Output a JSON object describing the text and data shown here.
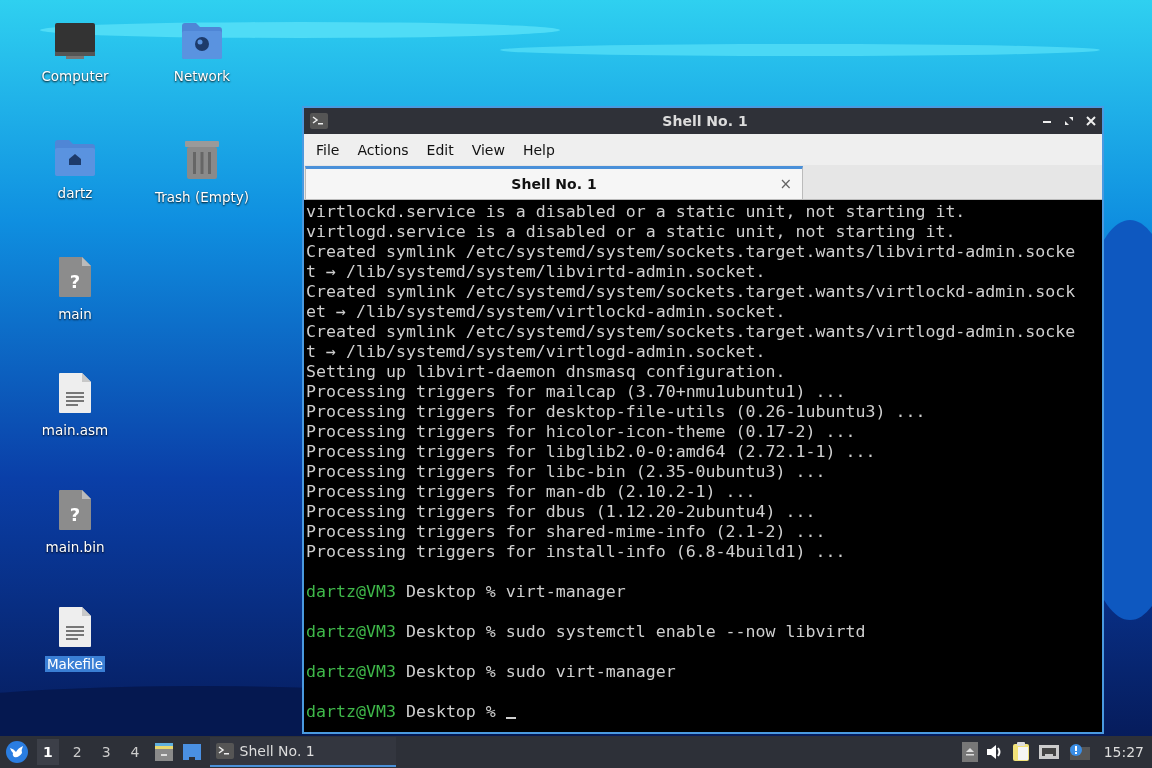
{
  "desktop_icons": [
    {
      "label": "Computer",
      "kind": "computer",
      "selected": false
    },
    {
      "label": "dartz",
      "kind": "home-folder",
      "selected": false
    },
    {
      "label": "main",
      "kind": "unknown-file",
      "glyph": "?",
      "selected": false
    },
    {
      "label": "main.asm",
      "kind": "text-file",
      "selected": false
    },
    {
      "label": "main.bin",
      "kind": "unknown-file",
      "glyph": "?",
      "selected": false
    },
    {
      "label": "Makefile",
      "kind": "text-file",
      "selected": true
    },
    {
      "label": "Network",
      "kind": "network-folder",
      "selected": false
    },
    {
      "label": "Trash (Empty)",
      "kind": "trash",
      "selected": false
    }
  ],
  "window": {
    "title": "Shell No. 1",
    "menu": [
      "File",
      "Actions",
      "Edit",
      "View",
      "Help"
    ],
    "tabs": [
      {
        "label": "Shell No. 1",
        "close": "×",
        "selected": true
      }
    ],
    "terminal": [
      {
        "kind": "output",
        "text": "virtlockd.service is a disabled or a static unit, not starting it."
      },
      {
        "kind": "output",
        "text": "virtlogd.service is a disabled or a static unit, not starting it."
      },
      {
        "kind": "output",
        "text": "Created symlink /etc/systemd/system/sockets.target.wants/libvirtd-admin.socke"
      },
      {
        "kind": "output",
        "text": "t → /lib/systemd/system/libvirtd-admin.socket."
      },
      {
        "kind": "output",
        "text": "Created symlink /etc/systemd/system/sockets.target.wants/virtlockd-admin.sock"
      },
      {
        "kind": "output",
        "text": "et → /lib/systemd/system/virtlockd-admin.socket."
      },
      {
        "kind": "output",
        "text": "Created symlink /etc/systemd/system/sockets.target.wants/virtlogd-admin.socke"
      },
      {
        "kind": "output",
        "text": "t → /lib/systemd/system/virtlogd-admin.socket."
      },
      {
        "kind": "output",
        "text": "Setting up libvirt-daemon dnsmasq configuration."
      },
      {
        "kind": "output",
        "text": "Processing triggers for mailcap (3.70+nmu1ubuntu1) ..."
      },
      {
        "kind": "output",
        "text": "Processing triggers for desktop-file-utils (0.26-1ubuntu3) ..."
      },
      {
        "kind": "output",
        "text": "Processing triggers for hicolor-icon-theme (0.17-2) ..."
      },
      {
        "kind": "output",
        "text": "Processing triggers for libglib2.0-0:amd64 (2.72.1-1) ..."
      },
      {
        "kind": "output",
        "text": "Processing triggers for libc-bin (2.35-0ubuntu3) ..."
      },
      {
        "kind": "output",
        "text": "Processing triggers for man-db (2.10.2-1) ..."
      },
      {
        "kind": "output",
        "text": "Processing triggers for dbus (1.12.20-2ubuntu4) ..."
      },
      {
        "kind": "output",
        "text": "Processing triggers for shared-mime-info (2.1-2) ..."
      },
      {
        "kind": "output",
        "text": "Processing triggers for install-info (6.8-4build1) ..."
      },
      {
        "kind": "blank"
      },
      {
        "kind": "prompt",
        "user": "dartz@VM3",
        "text": "Desktop % virt-manager",
        "cursor": false
      },
      {
        "kind": "blank"
      },
      {
        "kind": "prompt",
        "user": "dartz@VM3",
        "text": "Desktop % sudo systemctl enable --now libvirtd",
        "cursor": false
      },
      {
        "kind": "blank"
      },
      {
        "kind": "prompt",
        "user": "dartz@VM3",
        "text": "Desktop % sudo virt-manager",
        "cursor": false
      },
      {
        "kind": "blank"
      },
      {
        "kind": "prompt",
        "user": "dartz@VM3",
        "text": "Desktop % ",
        "cursor": true
      }
    ]
  },
  "taskbar": {
    "workspaces": [
      {
        "label": "1",
        "selected": true
      },
      {
        "label": "2",
        "selected": false
      },
      {
        "label": "3",
        "selected": false
      },
      {
        "label": "4",
        "selected": false
      }
    ],
    "tasks": [
      {
        "label": "Shell No. 1",
        "selected": true
      }
    ],
    "clock": "15:27"
  }
}
